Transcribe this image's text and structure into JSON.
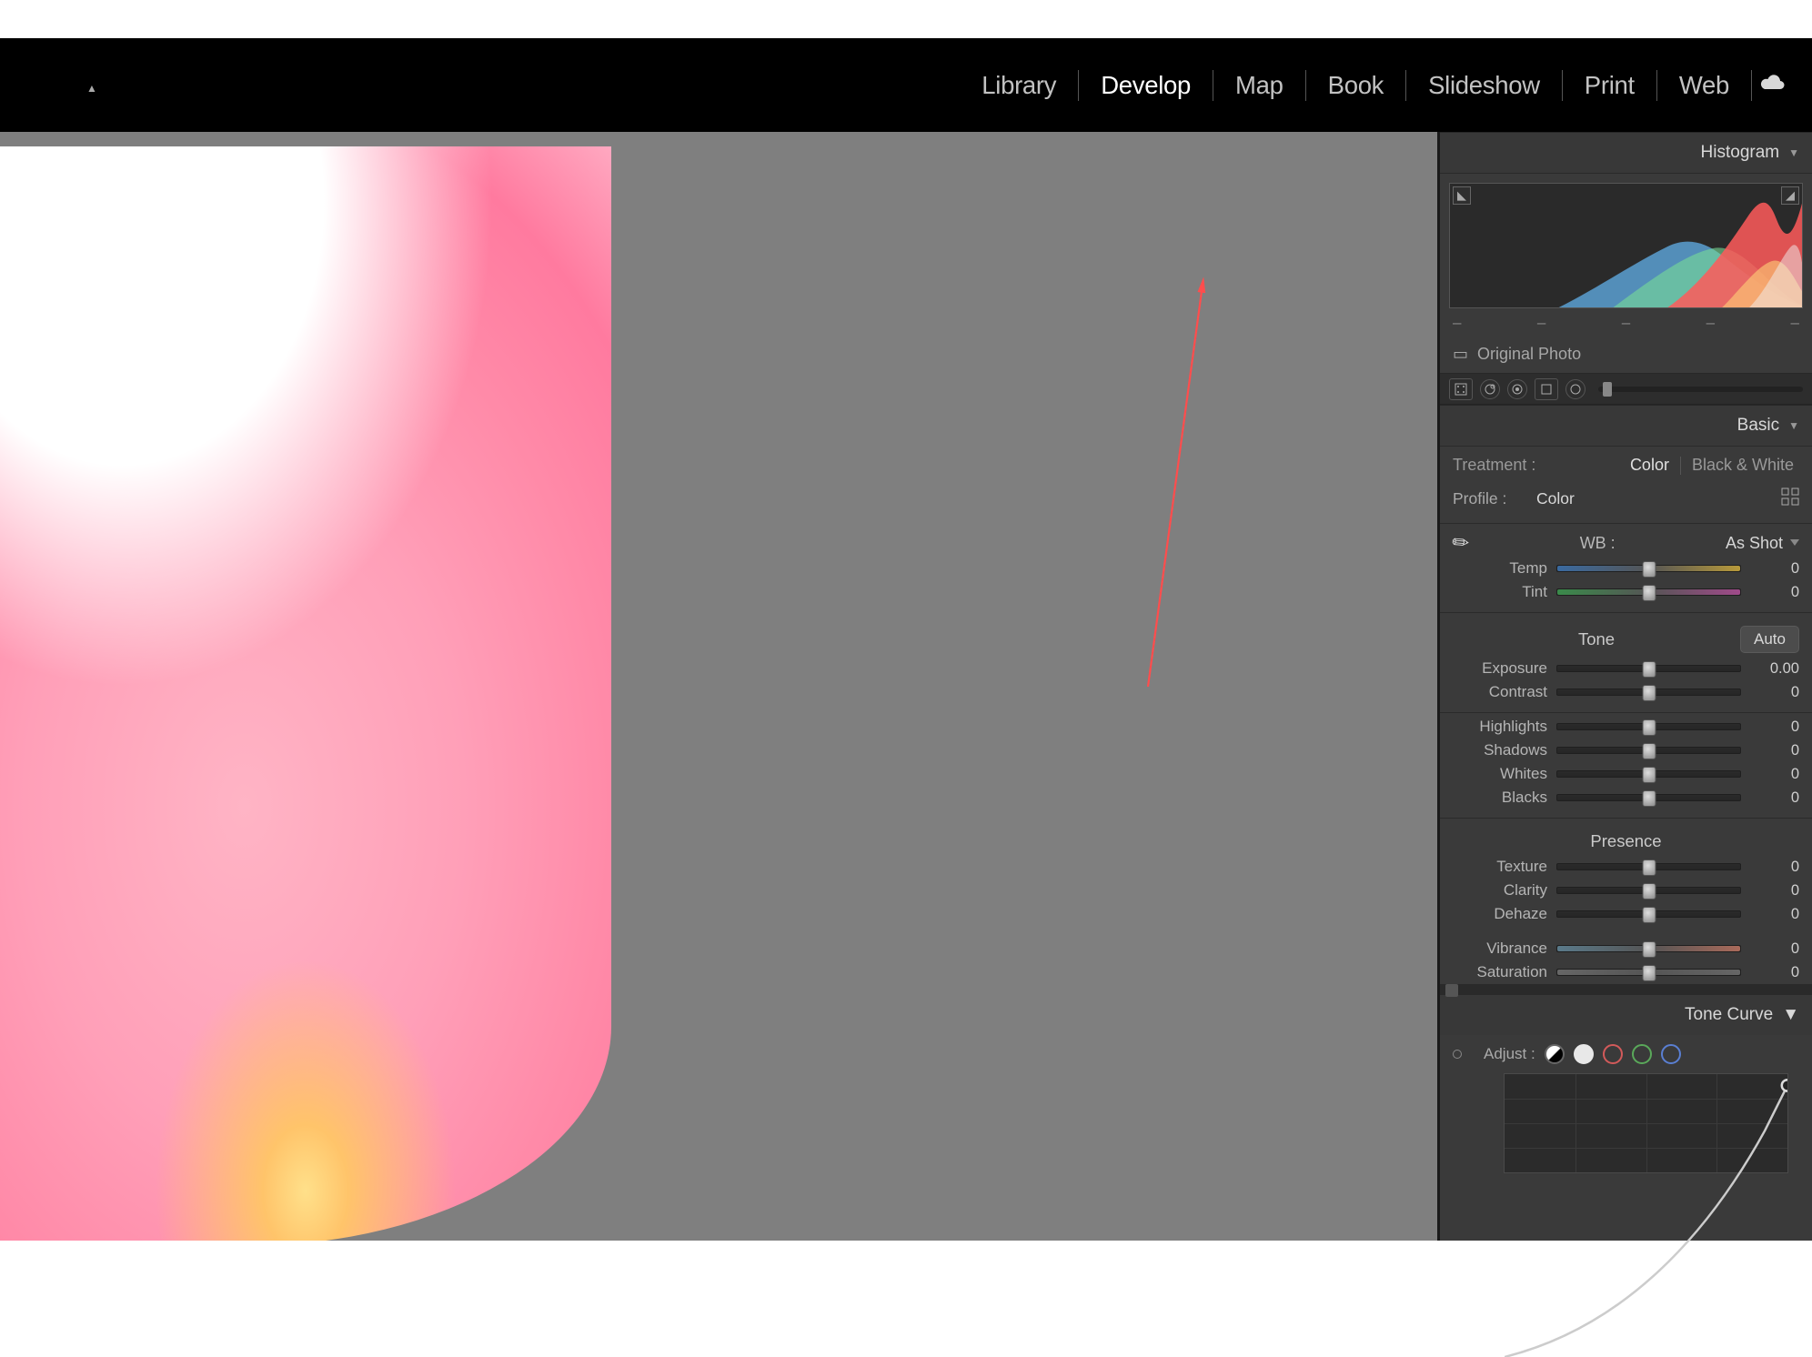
{
  "modules": {
    "library": "Library",
    "develop": "Develop",
    "map": "Map",
    "book": "Book",
    "slideshow": "Slideshow",
    "print": "Print",
    "web": "Web",
    "active": "develop"
  },
  "histogram": {
    "title": "Histogram",
    "ticks": [
      "–",
      "–",
      "–",
      "–",
      "–"
    ],
    "original_label": "Original Photo"
  },
  "basic": {
    "title": "Basic",
    "treatment_label": "Treatment :",
    "treatment_color": "Color",
    "treatment_bw": "Black & White",
    "profile_label": "Profile :",
    "profile_value": "Color",
    "wb_label": "WB :",
    "wb_value": "As Shot",
    "tone_label": "Tone",
    "auto_label": "Auto",
    "presence_label": "Presence",
    "sliders": {
      "temp": {
        "label": "Temp",
        "value": "0"
      },
      "tint": {
        "label": "Tint",
        "value": "0"
      },
      "exposure": {
        "label": "Exposure",
        "value": "0.00"
      },
      "contrast": {
        "label": "Contrast",
        "value": "0"
      },
      "highlights": {
        "label": "Highlights",
        "value": "0"
      },
      "shadows": {
        "label": "Shadows",
        "value": "0"
      },
      "whites": {
        "label": "Whites",
        "value": "0"
      },
      "blacks": {
        "label": "Blacks",
        "value": "0"
      },
      "texture": {
        "label": "Texture",
        "value": "0"
      },
      "clarity": {
        "label": "Clarity",
        "value": "0"
      },
      "dehaze": {
        "label": "Dehaze",
        "value": "0"
      },
      "vibrance": {
        "label": "Vibrance",
        "value": "0"
      },
      "saturation": {
        "label": "Saturation",
        "value": "0"
      }
    }
  },
  "tone_curve": {
    "title": "Tone Curve",
    "adjust_label": "Adjust :"
  }
}
